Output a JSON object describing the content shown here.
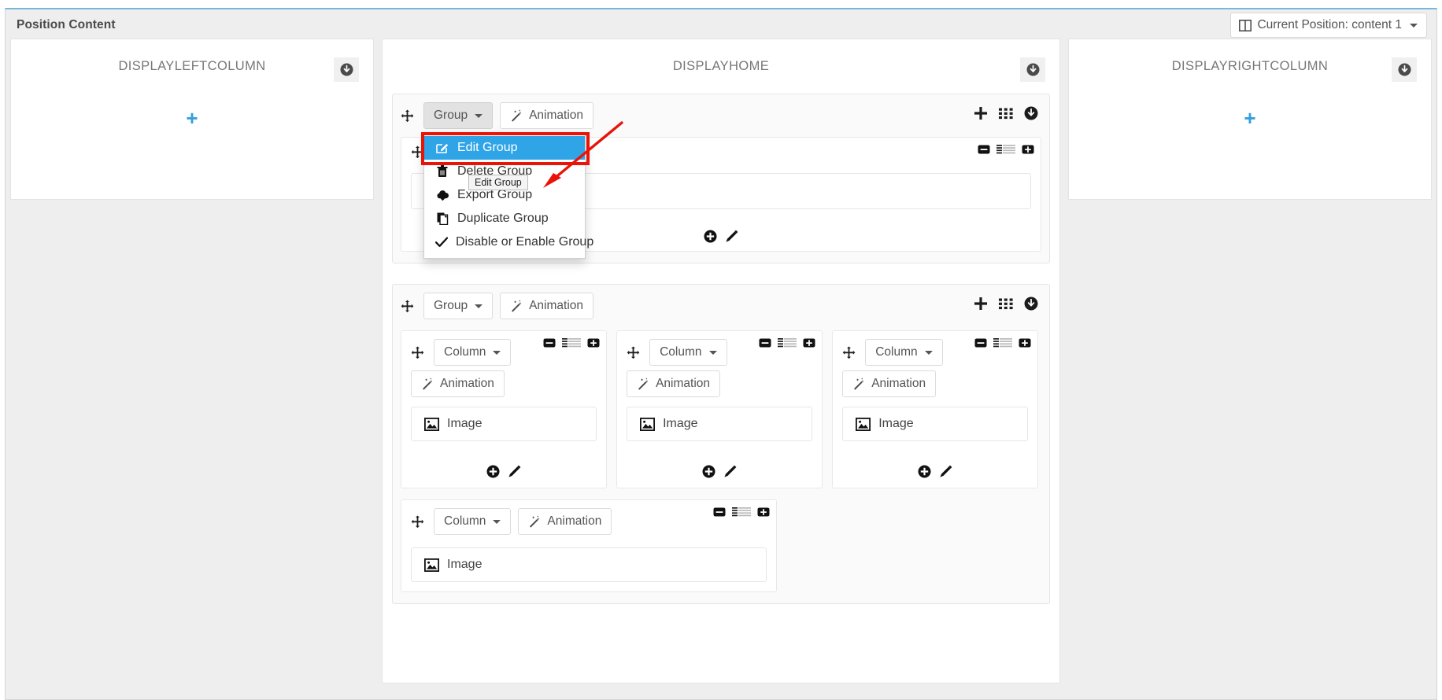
{
  "header": {
    "title": "Position Content",
    "position_selector": {
      "icon": "columns-icon",
      "label": "Current Position: content 1",
      "caret": "caret-down-icon"
    }
  },
  "zones": {
    "left": {
      "title": "DISPLAYLEFTCOLUMN",
      "download_icon": "arrow-circle-down-icon",
      "add_label": "+"
    },
    "center": {
      "title": "DISPLAYHOME",
      "download_icon": "arrow-circle-down-icon"
    },
    "right": {
      "title": "DISPLAYRIGHTCOLUMN",
      "download_icon": "arrow-circle-down-icon",
      "add_label": "+"
    }
  },
  "labels": {
    "group": "Group",
    "column": "Column",
    "animation": "Animation",
    "image": "Image"
  },
  "group_tools": {
    "add": "plus-icon",
    "grid": "th-grid-icon",
    "download": "arrow-circle-down-icon"
  },
  "column_tools": {
    "minus": "minus-square-icon",
    "bars": "align-justify-icon",
    "plus": "plus-square-icon"
  },
  "column_footer": {
    "add": "plus-circle-icon",
    "edit": "pencil-icon"
  },
  "dropdown": {
    "open": true,
    "items": [
      {
        "label": "Edit Group",
        "icon": "edit-square-icon",
        "selected": true
      },
      {
        "label": "Delete Group",
        "icon": "trash-icon",
        "selected": false
      },
      {
        "label": "Export Group",
        "icon": "cloud-download-icon",
        "selected": false
      },
      {
        "label": "Duplicate Group",
        "icon": "copy-icon",
        "selected": false
      },
      {
        "label": "Disable or Enable Group",
        "icon": "check-icon",
        "selected": false
      }
    ],
    "tooltip": "Edit Group"
  },
  "groups": [
    {
      "name": "group-1",
      "columns": [
        {
          "name": "column-1-1",
          "elements": [
            {
              "type": "Image"
            }
          ]
        }
      ]
    },
    {
      "name": "group-2",
      "columns": [
        {
          "name": "column-2-1",
          "elements": [
            {
              "type": "Image"
            }
          ]
        },
        {
          "name": "column-2-2",
          "elements": [
            {
              "type": "Image"
            }
          ]
        },
        {
          "name": "column-2-3",
          "elements": [
            {
              "type": "Image"
            }
          ]
        },
        {
          "name": "column-2-4",
          "elements": [
            {
              "type": "Image"
            }
          ]
        }
      ]
    }
  ],
  "colors": {
    "accent_blue": "#2fa4e7",
    "annotation_red": "#e81309",
    "panel_bg": "#eeeeee",
    "zone_bg": "#ffffff"
  }
}
